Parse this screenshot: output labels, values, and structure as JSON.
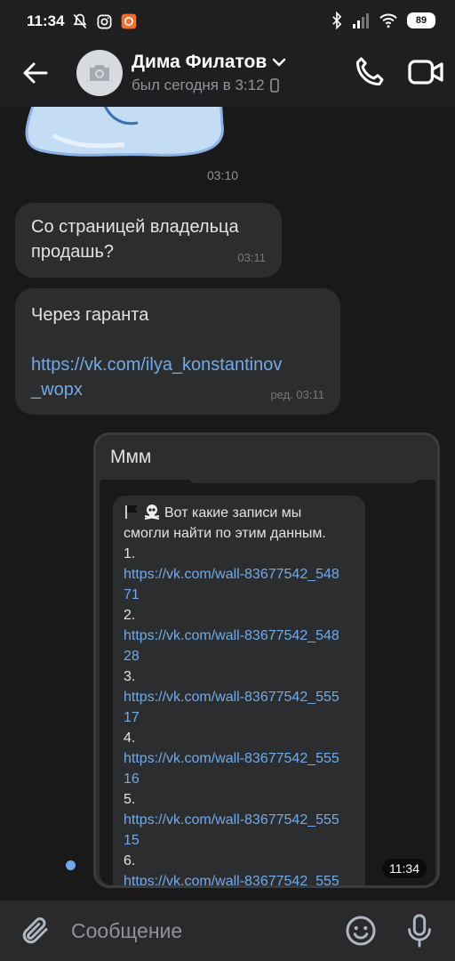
{
  "status_bar": {
    "time": "11:34",
    "battery": "89"
  },
  "header": {
    "name": "Дима Филатов",
    "status": "был сегодня в 3:12"
  },
  "messages": [
    {
      "kind": "sticker",
      "time": "03:10"
    },
    {
      "kind": "incoming",
      "lines": [
        "Со страницей владельца",
        "продашь?"
      ],
      "time": "03:11"
    },
    {
      "kind": "incoming",
      "text": "Через гаранта",
      "link_lines": [
        "https://vk.com/ilya_konstantinov",
        "_wopx"
      ],
      "time": "ред. 03:11"
    }
  ],
  "outgoing": {
    "text": "Ммм",
    "time": "11:34",
    "forwarded": {
      "intro_lines": [
        "Вот какие записи мы",
        "смогли найти по этим данным."
      ],
      "items": [
        {
          "num": "1.",
          "link_a": "https://vk.com/wall-83677542_548",
          "link_b": "71"
        },
        {
          "num": "2.",
          "link_a": "https://vk.com/wall-83677542_548",
          "link_b": "28"
        },
        {
          "num": "3.",
          "link_a": "https://vk.com/wall-83677542_555",
          "link_b": "17"
        },
        {
          "num": "4.",
          "link_a": "https://vk.com/wall-83677542_555",
          "link_b": "16"
        },
        {
          "num": "5.",
          "link_a": "https://vk.com/wall-83677542_555",
          "link_b": "15"
        },
        {
          "num": "6.",
          "link_a": "https://vk.com/wall-83677542_555",
          "link_b": ""
        }
      ]
    }
  },
  "composer": {
    "placeholder": "Сообщение"
  },
  "colors": {
    "link": "#71aaeb",
    "bubble": "#2c2d2e",
    "background": "#19191a"
  }
}
